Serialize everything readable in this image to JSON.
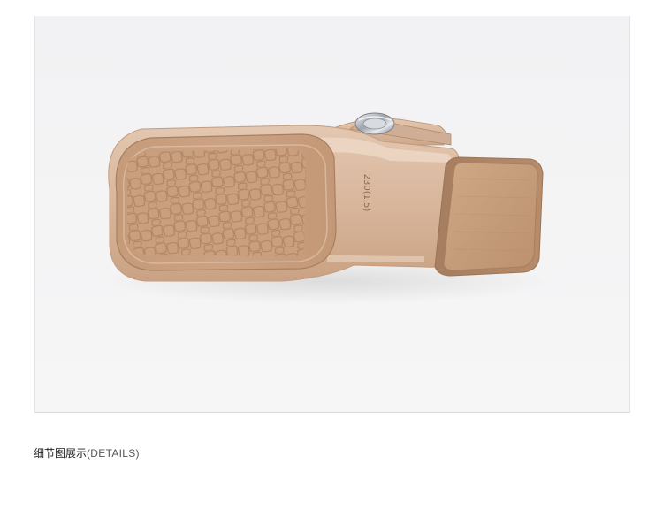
{
  "section": {
    "title_cn": "细节图展示",
    "title_en": "(DETAILS)"
  },
  "product": {
    "sole_size_marking": "230(1.5)",
    "colors": {
      "patent_upper": "#d6b49a",
      "sole": "#c49a78",
      "heel": "#c8a07c",
      "buckle": "#c9ccd0",
      "background": "#f3f3f4"
    }
  }
}
